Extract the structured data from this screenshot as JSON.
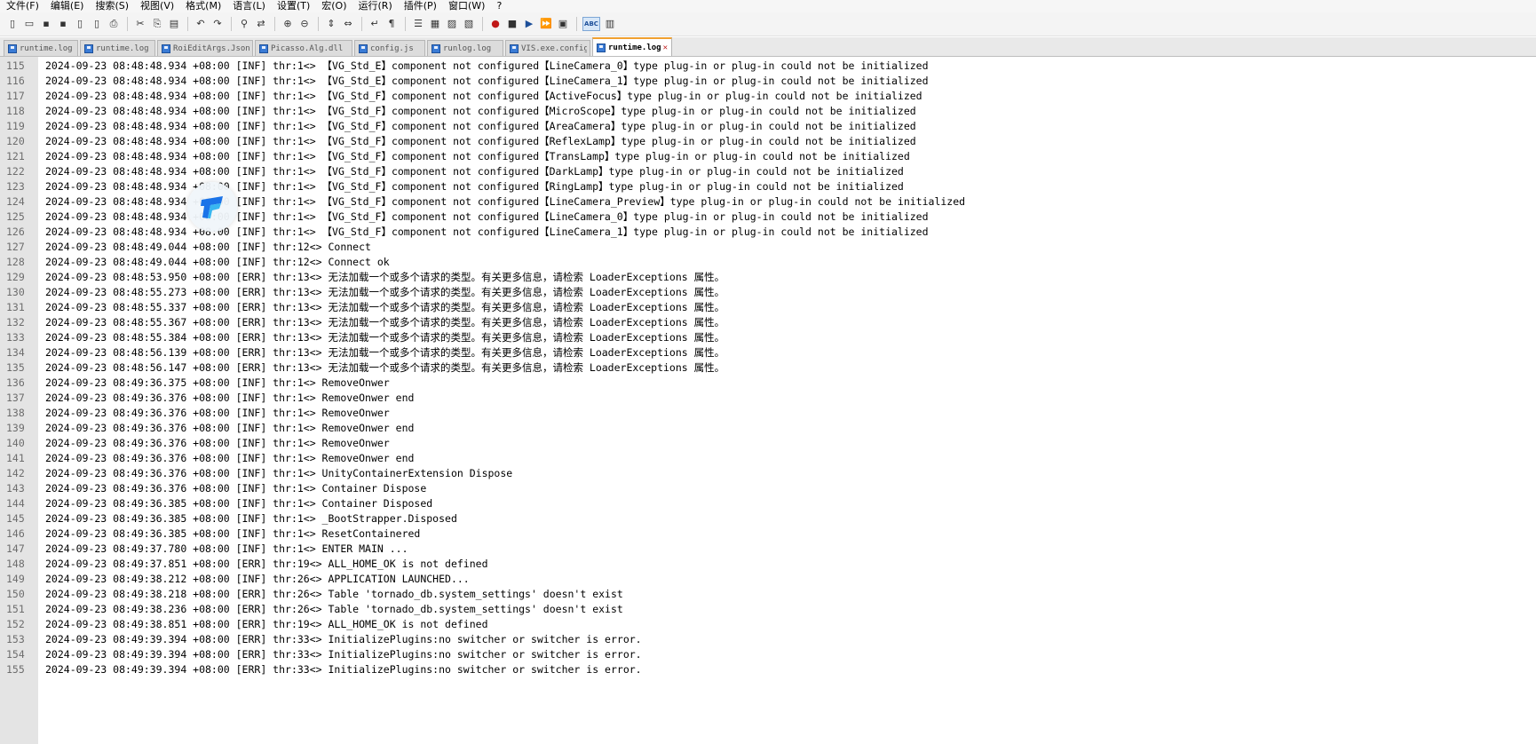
{
  "menu": [
    "文件(F)",
    "编辑(E)",
    "搜索(S)",
    "视图(V)",
    "格式(M)",
    "语言(L)",
    "设置(T)",
    "宏(O)",
    "运行(R)",
    "插件(P)",
    "窗口(W)",
    "?"
  ],
  "toolbar": {
    "groups": [
      [
        "new-file-icon",
        "open-file-icon",
        "save-icon",
        "save-all-icon",
        "close-file-icon",
        "close-all-icon",
        "print-icon"
      ],
      [
        "cut-icon",
        "copy-icon",
        "paste-icon"
      ],
      [
        "undo-icon",
        "redo-icon"
      ],
      [
        "find-icon",
        "replace-icon"
      ],
      [
        "zoom-in-icon",
        "zoom-out-icon"
      ],
      [
        "sync-vertical-icon",
        "sync-horizontal-icon"
      ],
      [
        "word-wrap-icon",
        "show-all-chars-icon"
      ],
      [
        "indent-guide-icon",
        "user-language-icon",
        "function-list-icon",
        "doc-map-icon"
      ],
      [
        "record-macro-icon",
        "stop-macro-icon",
        "play-macro-icon",
        "play-multiple-macro-icon",
        "save-macro-icon"
      ],
      [
        "spellcheck-icon",
        "spellcheck-options-icon"
      ]
    ],
    "glyphs": {
      "new-file-icon": "▯",
      "open-file-icon": "▭",
      "save-icon": "▪",
      "save-all-icon": "▪",
      "close-file-icon": "▯",
      "close-all-icon": "▯",
      "print-icon": "⎙",
      "cut-icon": "✂",
      "copy-icon": "⎘",
      "paste-icon": "▤",
      "undo-icon": "↶",
      "redo-icon": "↷",
      "find-icon": "⚲",
      "replace-icon": "⇄",
      "zoom-in-icon": "⊕",
      "zoom-out-icon": "⊖",
      "sync-vertical-icon": "⇕",
      "sync-horizontal-icon": "⇔",
      "word-wrap-icon": "↵",
      "show-all-chars-icon": "¶",
      "indent-guide-icon": "☰",
      "user-language-icon": "▦",
      "function-list-icon": "▨",
      "doc-map-icon": "▧",
      "record-macro-icon": "●",
      "stop-macro-icon": "■",
      "play-macro-icon": "▶",
      "play-multiple-macro-icon": "⏩",
      "save-macro-icon": "▣",
      "spellcheck-icon": "ABC",
      "spellcheck-options-icon": "▥"
    },
    "active": "spellcheck-icon"
  },
  "tabs": [
    {
      "label": "runtime.log",
      "active": false,
      "width": 84
    },
    {
      "label": "runtime.log",
      "active": false,
      "width": 85
    },
    {
      "label": "RoiEditArgs.Json",
      "active": false,
      "width": 108
    },
    {
      "label": "Picasso.Alg.dll",
      "active": false,
      "width": 110
    },
    {
      "label": "config.js",
      "active": false,
      "width": 80
    },
    {
      "label": "runlog.log",
      "active": false,
      "width": 86
    },
    {
      "label": "VIS.exe.config",
      "active": false,
      "width": 96
    },
    {
      "label": "runtime.log",
      "active": true,
      "width": 90
    }
  ],
  "colors": {
    "accent_tab": "#f0a030",
    "close_icon": "#c02020",
    "badge_dark": "#1a73e8",
    "badge_light": "#38b6f0"
  },
  "editor": {
    "lines": [
      {
        "n": "115",
        "text": "2024-09-23 08:48:48.934 +08:00 [INF] thr:1<> 【VG_Std_E】component not configured【LineCamera_0】type plug-in or plug-in could not be initialized"
      },
      {
        "n": "116",
        "text": "2024-09-23 08:48:48.934 +08:00 [INF] thr:1<> 【VG_Std_E】component not configured【LineCamera_1】type plug-in or plug-in could not be initialized"
      },
      {
        "n": "117",
        "text": "2024-09-23 08:48:48.934 +08:00 [INF] thr:1<> 【VG_Std_F】component not configured【ActiveFocus】type plug-in or plug-in could not be initialized"
      },
      {
        "n": "118",
        "text": "2024-09-23 08:48:48.934 +08:00 [INF] thr:1<> 【VG_Std_F】component not configured【MicroScope】type plug-in or plug-in could not be initialized"
      },
      {
        "n": "119",
        "text": "2024-09-23 08:48:48.934 +08:00 [INF] thr:1<> 【VG_Std_F】component not configured【AreaCamera】type plug-in or plug-in could not be initialized"
      },
      {
        "n": "120",
        "text": "2024-09-23 08:48:48.934 +08:00 [INF] thr:1<> 【VG_Std_F】component not configured【ReflexLamp】type plug-in or plug-in could not be initialized"
      },
      {
        "n": "121",
        "text": "2024-09-23 08:48:48.934 +08:00 [INF] thr:1<> 【VG_Std_F】component not configured【TransLamp】type plug-in or plug-in could not be initialized"
      },
      {
        "n": "122",
        "text": "2024-09-23 08:48:48.934 +08:00 [INF] thr:1<> 【VG_Std_F】component not configured【DarkLamp】type plug-in or plug-in could not be initialized"
      },
      {
        "n": "123",
        "text": "2024-09-23 08:48:48.934 +08:00 [INF] thr:1<> 【VG_Std_F】component not configured【RingLamp】type plug-in or plug-in could not be initialized"
      },
      {
        "n": "124",
        "text": "2024-09-23 08:48:48.934 +08:00 [INF] thr:1<> 【VG_Std_F】component not configured【LineCamera_Preview】type plug-in or plug-in could not be initialized"
      },
      {
        "n": "125",
        "text": "2024-09-23 08:48:48.934 +08:00 [INF] thr:1<> 【VG_Std_F】component not configured【LineCamera_0】type plug-in or plug-in could not be initialized"
      },
      {
        "n": "126",
        "text": "2024-09-23 08:48:48.934 +08:00 [INF] thr:1<> 【VG_Std_F】component not configured【LineCamera_1】type plug-in or plug-in could not be initialized"
      },
      {
        "n": "127",
        "text": "2024-09-23 08:48:49.044 +08:00 [INF] thr:12<> Connect"
      },
      {
        "n": "128",
        "text": "2024-09-23 08:48:49.044 +08:00 [INF] thr:12<> Connect ok"
      },
      {
        "n": "129",
        "text": "2024-09-23 08:48:53.950 +08:00 [ERR] thr:13<> 无法加载一个或多个请求的类型。有关更多信息，请检索 LoaderExceptions 属性。"
      },
      {
        "n": "130",
        "text": "2024-09-23 08:48:55.273 +08:00 [ERR] thr:13<> 无法加载一个或多个请求的类型。有关更多信息，请检索 LoaderExceptions 属性。"
      },
      {
        "n": "131",
        "text": "2024-09-23 08:48:55.337 +08:00 [ERR] thr:13<> 无法加载一个或多个请求的类型。有关更多信息，请检索 LoaderExceptions 属性。"
      },
      {
        "n": "132",
        "text": "2024-09-23 08:48:55.367 +08:00 [ERR] thr:13<> 无法加载一个或多个请求的类型。有关更多信息，请检索 LoaderExceptions 属性。"
      },
      {
        "n": "133",
        "text": "2024-09-23 08:48:55.384 +08:00 [ERR] thr:13<> 无法加载一个或多个请求的类型。有关更多信息，请检索 LoaderExceptions 属性。"
      },
      {
        "n": "134",
        "text": "2024-09-23 08:48:56.139 +08:00 [ERR] thr:13<> 无法加载一个或多个请求的类型。有关更多信息，请检索 LoaderExceptions 属性。"
      },
      {
        "n": "135",
        "text": "2024-09-23 08:48:56.147 +08:00 [ERR] thr:13<> 无法加载一个或多个请求的类型。有关更多信息，请检索 LoaderExceptions 属性。"
      },
      {
        "n": "136",
        "text": "2024-09-23 08:49:36.375 +08:00 [INF] thr:1<> RemoveOnwer"
      },
      {
        "n": "137",
        "text": "2024-09-23 08:49:36.376 +08:00 [INF] thr:1<> RemoveOnwer end"
      },
      {
        "n": "138",
        "text": "2024-09-23 08:49:36.376 +08:00 [INF] thr:1<> RemoveOnwer"
      },
      {
        "n": "139",
        "text": "2024-09-23 08:49:36.376 +08:00 [INF] thr:1<> RemoveOnwer end"
      },
      {
        "n": "140",
        "text": "2024-09-23 08:49:36.376 +08:00 [INF] thr:1<> RemoveOnwer"
      },
      {
        "n": "141",
        "text": "2024-09-23 08:49:36.376 +08:00 [INF] thr:1<> RemoveOnwer end"
      },
      {
        "n": "142",
        "text": "2024-09-23 08:49:36.376 +08:00 [INF] thr:1<> UnityContainerExtension Dispose"
      },
      {
        "n": "143",
        "text": "2024-09-23 08:49:36.376 +08:00 [INF] thr:1<> Container Dispose"
      },
      {
        "n": "144",
        "text": "2024-09-23 08:49:36.385 +08:00 [INF] thr:1<> Container Disposed"
      },
      {
        "n": "145",
        "text": "2024-09-23 08:49:36.385 +08:00 [INF] thr:1<> _BootStrapper.Disposed"
      },
      {
        "n": "146",
        "text": "2024-09-23 08:49:36.385 +08:00 [INF] thr:1<> ResetContainered"
      },
      {
        "n": "147",
        "text": "2024-09-23 08:49:37.780 +08:00 [INF] thr:1<> ENTER MAIN ..."
      },
      {
        "n": "148",
        "text": "2024-09-23 08:49:37.851 +08:00 [ERR] thr:19<> ALL_HOME_OK is not defined"
      },
      {
        "n": "149",
        "text": "2024-09-23 08:49:38.212 +08:00 [INF] thr:26<> APPLICATION LAUNCHED..."
      },
      {
        "n": "150",
        "text": "2024-09-23 08:49:38.218 +08:00 [ERR] thr:26<> Table 'tornado_db.system_settings' doesn't exist"
      },
      {
        "n": "151",
        "text": "2024-09-23 08:49:38.236 +08:00 [ERR] thr:26<> Table 'tornado_db.system_settings' doesn't exist"
      },
      {
        "n": "152",
        "text": "2024-09-23 08:49:38.851 +08:00 [ERR] thr:19<> ALL_HOME_OK is not defined"
      },
      {
        "n": "153",
        "text": "2024-09-23 08:49:39.394 +08:00 [ERR] thr:33<> InitializePlugins:no switcher or switcher is error."
      },
      {
        "n": "154",
        "text": "2024-09-23 08:49:39.394 +08:00 [ERR] thr:33<> InitializePlugins:no switcher or switcher is error."
      },
      {
        "n": "155",
        "text": "2024-09-23 08:49:39.394 +08:00 [ERR] thr:33<> InitializePlugins:no switcher or switcher is error."
      }
    ]
  }
}
